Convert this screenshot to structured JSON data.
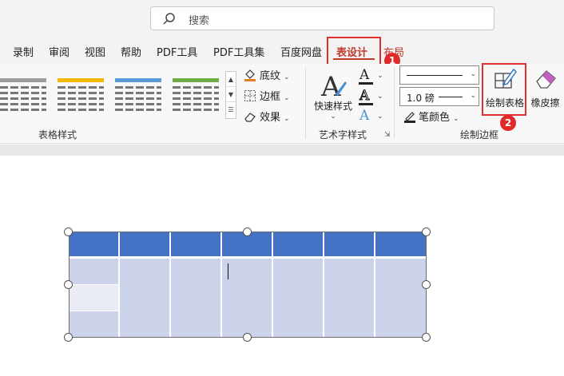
{
  "search": {
    "placeholder": "搜索"
  },
  "tabs": [
    {
      "label": "录制"
    },
    {
      "label": "审阅"
    },
    {
      "label": "视图"
    },
    {
      "label": "帮助"
    },
    {
      "label": "PDF工具"
    },
    {
      "label": "PDF工具集"
    },
    {
      "label": "百度网盘"
    },
    {
      "label": "表设计"
    },
    {
      "label": "布局"
    }
  ],
  "annotations": {
    "badge1": "1",
    "badge2": "2"
  },
  "ribbon": {
    "table_styles": {
      "label": "表格样式",
      "thumb_colors": [
        "#9e9e9e",
        "#f2b800",
        "#5b9bd5",
        "#70ad47"
      ],
      "shading_label": "底纹",
      "borders_label": "边框",
      "effects_label": "效果"
    },
    "wordart": {
      "label": "艺术字样式",
      "quick_styles_label": "快速样式",
      "text_fill_color": "#222222",
      "text_outline_color": "#222222",
      "text_effects_color": "#4a90d9"
    },
    "draw_borders": {
      "label": "绘制边框",
      "line_weight": "1.0 磅",
      "pen_color_label": "笔颜色",
      "draw_table_label": "绘制表格",
      "eraser_label": "橡皮擦"
    }
  },
  "colors": {
    "accent": "#c0392b",
    "callout": "#e03030",
    "table_header": "#4472c4",
    "table_body": "#ccd3ea"
  }
}
